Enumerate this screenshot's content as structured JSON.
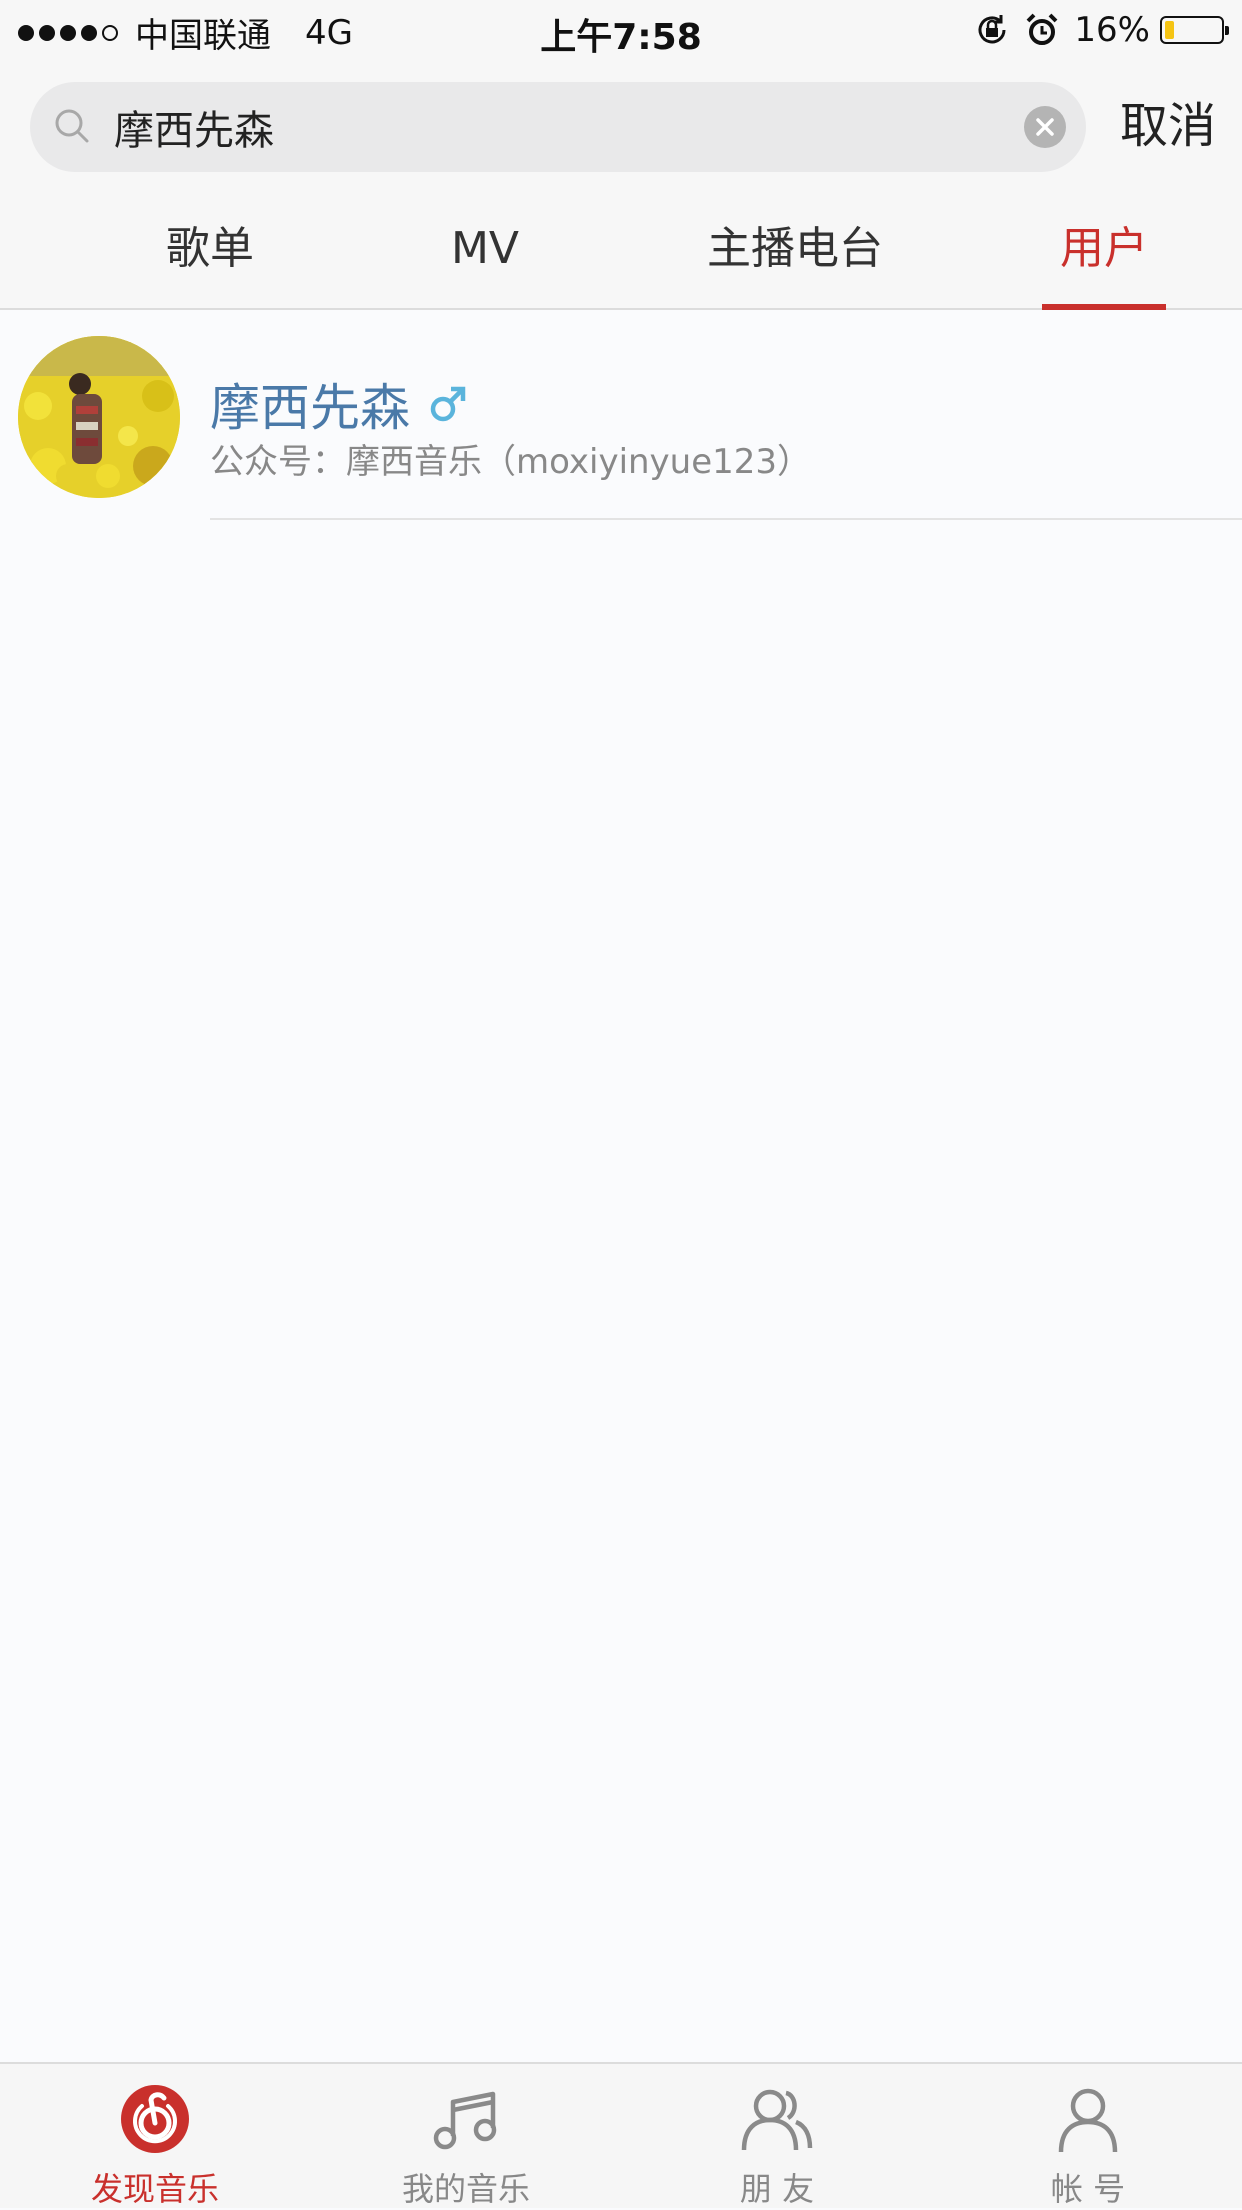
{
  "status_bar": {
    "carrier": "中国联通",
    "network": "4G",
    "time": "上午7:58",
    "battery_percent": "16%",
    "battery_level": 0.16,
    "signal_bars": 4,
    "signal_total": 5
  },
  "search": {
    "query": "摩西先森",
    "cancel_label": "取消"
  },
  "tabs": [
    {
      "label": "歌单",
      "active": false
    },
    {
      "label": "MV",
      "active": false
    },
    {
      "label": "主播电台",
      "active": false
    },
    {
      "label": "用户",
      "active": true
    }
  ],
  "results": [
    {
      "name": "摩西先森",
      "gender": "male",
      "description": "公众号：摩西音乐（moxiyinyue123）"
    }
  ],
  "tabbar": {
    "items": [
      {
        "label": "发现音乐",
        "icon": "netease-music-icon",
        "active": true
      },
      {
        "label": "我的音乐",
        "icon": "music-note-icon",
        "active": false
      },
      {
        "label": "朋 友",
        "icon": "friends-icon",
        "active": false
      },
      {
        "label": "帐 号",
        "icon": "account-icon",
        "active": false
      }
    ]
  },
  "colors": {
    "accent": "#c9302c",
    "username": "#4a79a8",
    "male_icon": "#5ab4dc"
  }
}
